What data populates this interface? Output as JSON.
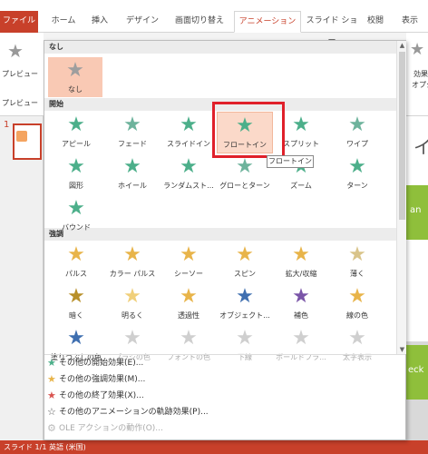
{
  "tabs": [
    "ファイル",
    "ホーム",
    "挿入",
    "デザイン",
    "画面切り替え",
    "アニメーション",
    "スライド ショー",
    "校閲",
    "表示"
  ],
  "ribbon": {
    "preview_label": "プレビュー",
    "preview_sub": "プレビュー",
    "effect_label": "効果",
    "effect_sub": "オプシ"
  },
  "slide_number": "1",
  "status_text": "スライド 1/1    英語 (米国)",
  "sections": {
    "none": "なし",
    "entrance": "開始",
    "emphasis": "強調"
  },
  "none_items": [
    {
      "label": "なし",
      "color": "#9e9e9e"
    }
  ],
  "entrance_items": [
    {
      "label": "アピール",
      "color": "#4caf8a"
    },
    {
      "label": "フェード",
      "color": "#6db39c"
    },
    {
      "label": "スライドイン",
      "color": "#4caf8a"
    },
    {
      "label": "フロートイン",
      "color": "#4caf8a"
    },
    {
      "label": "スプリット",
      "color": "#4caf8a"
    },
    {
      "label": "ワイプ",
      "color": "#6db39c"
    },
    {
      "label": "図形",
      "color": "#4caf8a"
    },
    {
      "label": "ホイール",
      "color": "#4caf8a"
    },
    {
      "label": "ランダムスト...",
      "color": "#4caf8a"
    },
    {
      "label": "グローとターン",
      "color": "#6db39c"
    },
    {
      "label": "ズーム",
      "color": "#4caf8a"
    },
    {
      "label": "ターン",
      "color": "#4caf8a"
    },
    {
      "label": "バウンド",
      "color": "#4caf8a"
    }
  ],
  "emphasis_items": [
    {
      "label": "パルス",
      "color": "#e8b44a"
    },
    {
      "label": "カラー パルス",
      "color": "#e8b44a"
    },
    {
      "label": "シーソー",
      "color": "#e8b44a"
    },
    {
      "label": "スピン",
      "color": "#e8b44a"
    },
    {
      "label": "拡大/収縮",
      "color": "#e8b44a"
    },
    {
      "label": "薄く",
      "color": "#d9c48a"
    },
    {
      "label": "暗く",
      "color": "#b8902a"
    },
    {
      "label": "明るく",
      "color": "#f0cf7a"
    },
    {
      "label": "透過性",
      "color": "#e8b44a"
    },
    {
      "label": "オブジェクト...",
      "color": "#3f6fb0"
    },
    {
      "label": "補色",
      "color": "#7a55a8"
    },
    {
      "label": "線の色",
      "color": "#e8b44a"
    },
    {
      "label": "塗りつぶしの色",
      "color": "#3f6fb0",
      "disabled": false
    },
    {
      "label": "ブラシの色",
      "color": "#cfcfcf",
      "disabled": true
    },
    {
      "label": "フォントの色",
      "color": "#cfcfcf",
      "disabled": true
    },
    {
      "label": "下線",
      "color": "#cfcfcf",
      "disabled": true
    },
    {
      "label": "ボールドフラ...",
      "color": "#cfcfcf",
      "disabled": true
    },
    {
      "label": "太字表示",
      "color": "#cfcfcf",
      "disabled": true
    }
  ],
  "tooltip": "フロートイン",
  "more_items": [
    {
      "label": "その他の開始効果(E)...",
      "color": "#4caf8a",
      "disabled": false
    },
    {
      "label": "その他の強調効果(M)...",
      "color": "#e8b44a",
      "disabled": false
    },
    {
      "label": "その他の終了効果(X)...",
      "color": "#d9534f",
      "disabled": false
    },
    {
      "label": "その他のアニメーションの軌跡効果(P)...",
      "color": "#555555",
      "disabled": false
    },
    {
      "label": "OLE アクションの動作(O)...",
      "color": "#bbbbbb",
      "disabled": true
    }
  ],
  "slide_text": {
    "side_char": "イ",
    "green1": "an",
    "green2": "eck"
  }
}
